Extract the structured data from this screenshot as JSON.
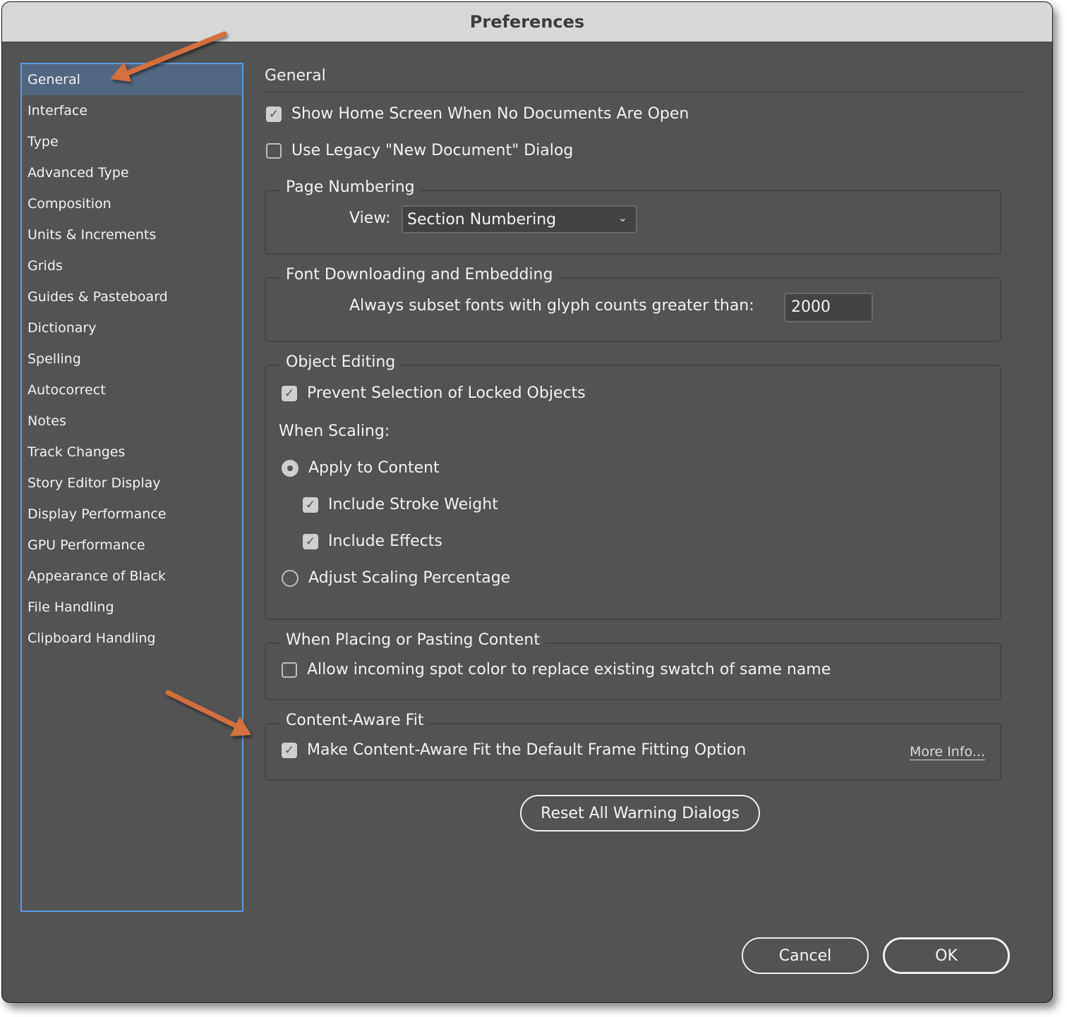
{
  "window": {
    "title": "Preferences"
  },
  "sidebar": {
    "items": [
      {
        "label": "General",
        "selected": true
      },
      {
        "label": "Interface"
      },
      {
        "label": "Type"
      },
      {
        "label": "Advanced Type"
      },
      {
        "label": "Composition"
      },
      {
        "label": "Units & Increments"
      },
      {
        "label": "Grids"
      },
      {
        "label": "Guides & Pasteboard"
      },
      {
        "label": "Dictionary"
      },
      {
        "label": "Spelling"
      },
      {
        "label": "Autocorrect"
      },
      {
        "label": "Notes"
      },
      {
        "label": "Track Changes"
      },
      {
        "label": "Story Editor Display"
      },
      {
        "label": "Display Performance"
      },
      {
        "label": "GPU Performance"
      },
      {
        "label": "Appearance of Black"
      },
      {
        "label": "File Handling"
      },
      {
        "label": "Clipboard Handling"
      }
    ]
  },
  "main": {
    "title": "General",
    "show_home_screen": {
      "label": "Show Home Screen When No Documents Are Open",
      "checked": true
    },
    "use_legacy_dialog": {
      "label": "Use Legacy \"New Document\" Dialog",
      "checked": false
    },
    "page_numbering": {
      "label": "Page Numbering",
      "view_label": "View:",
      "view_value": "Section Numbering"
    },
    "font_downloading": {
      "label": "Font Downloading and Embedding",
      "subset_label": "Always subset fonts with glyph counts greater than:",
      "subset_value": "2000"
    },
    "object_editing": {
      "label": "Object Editing",
      "prevent_selection": {
        "label": "Prevent Selection of Locked Objects",
        "checked": true
      },
      "when_scaling_label": "When Scaling:",
      "apply_to_content": {
        "label": "Apply to Content",
        "selected": true
      },
      "include_stroke": {
        "label": "Include Stroke Weight",
        "checked": true
      },
      "include_effects": {
        "label": "Include Effects",
        "checked": true
      },
      "adjust_scaling": {
        "label": "Adjust Scaling Percentage",
        "selected": false
      }
    },
    "placing_pasting": {
      "label": "When Placing or Pasting Content",
      "allow_spot": {
        "label": "Allow incoming spot color to replace existing swatch of same name",
        "checked": false
      }
    },
    "content_aware": {
      "label": "Content-Aware Fit",
      "make_default": {
        "label": "Make Content-Aware Fit the Default Frame Fitting Option",
        "checked": true
      },
      "more_info": "More Info..."
    },
    "reset_warnings": "Reset All Warning Dialogs"
  },
  "footer": {
    "cancel": "Cancel",
    "ok": "OK"
  },
  "annotations": {
    "arrow_color": "#d4703c"
  },
  "icons": {
    "check": "✓",
    "chevron": "⌄"
  }
}
